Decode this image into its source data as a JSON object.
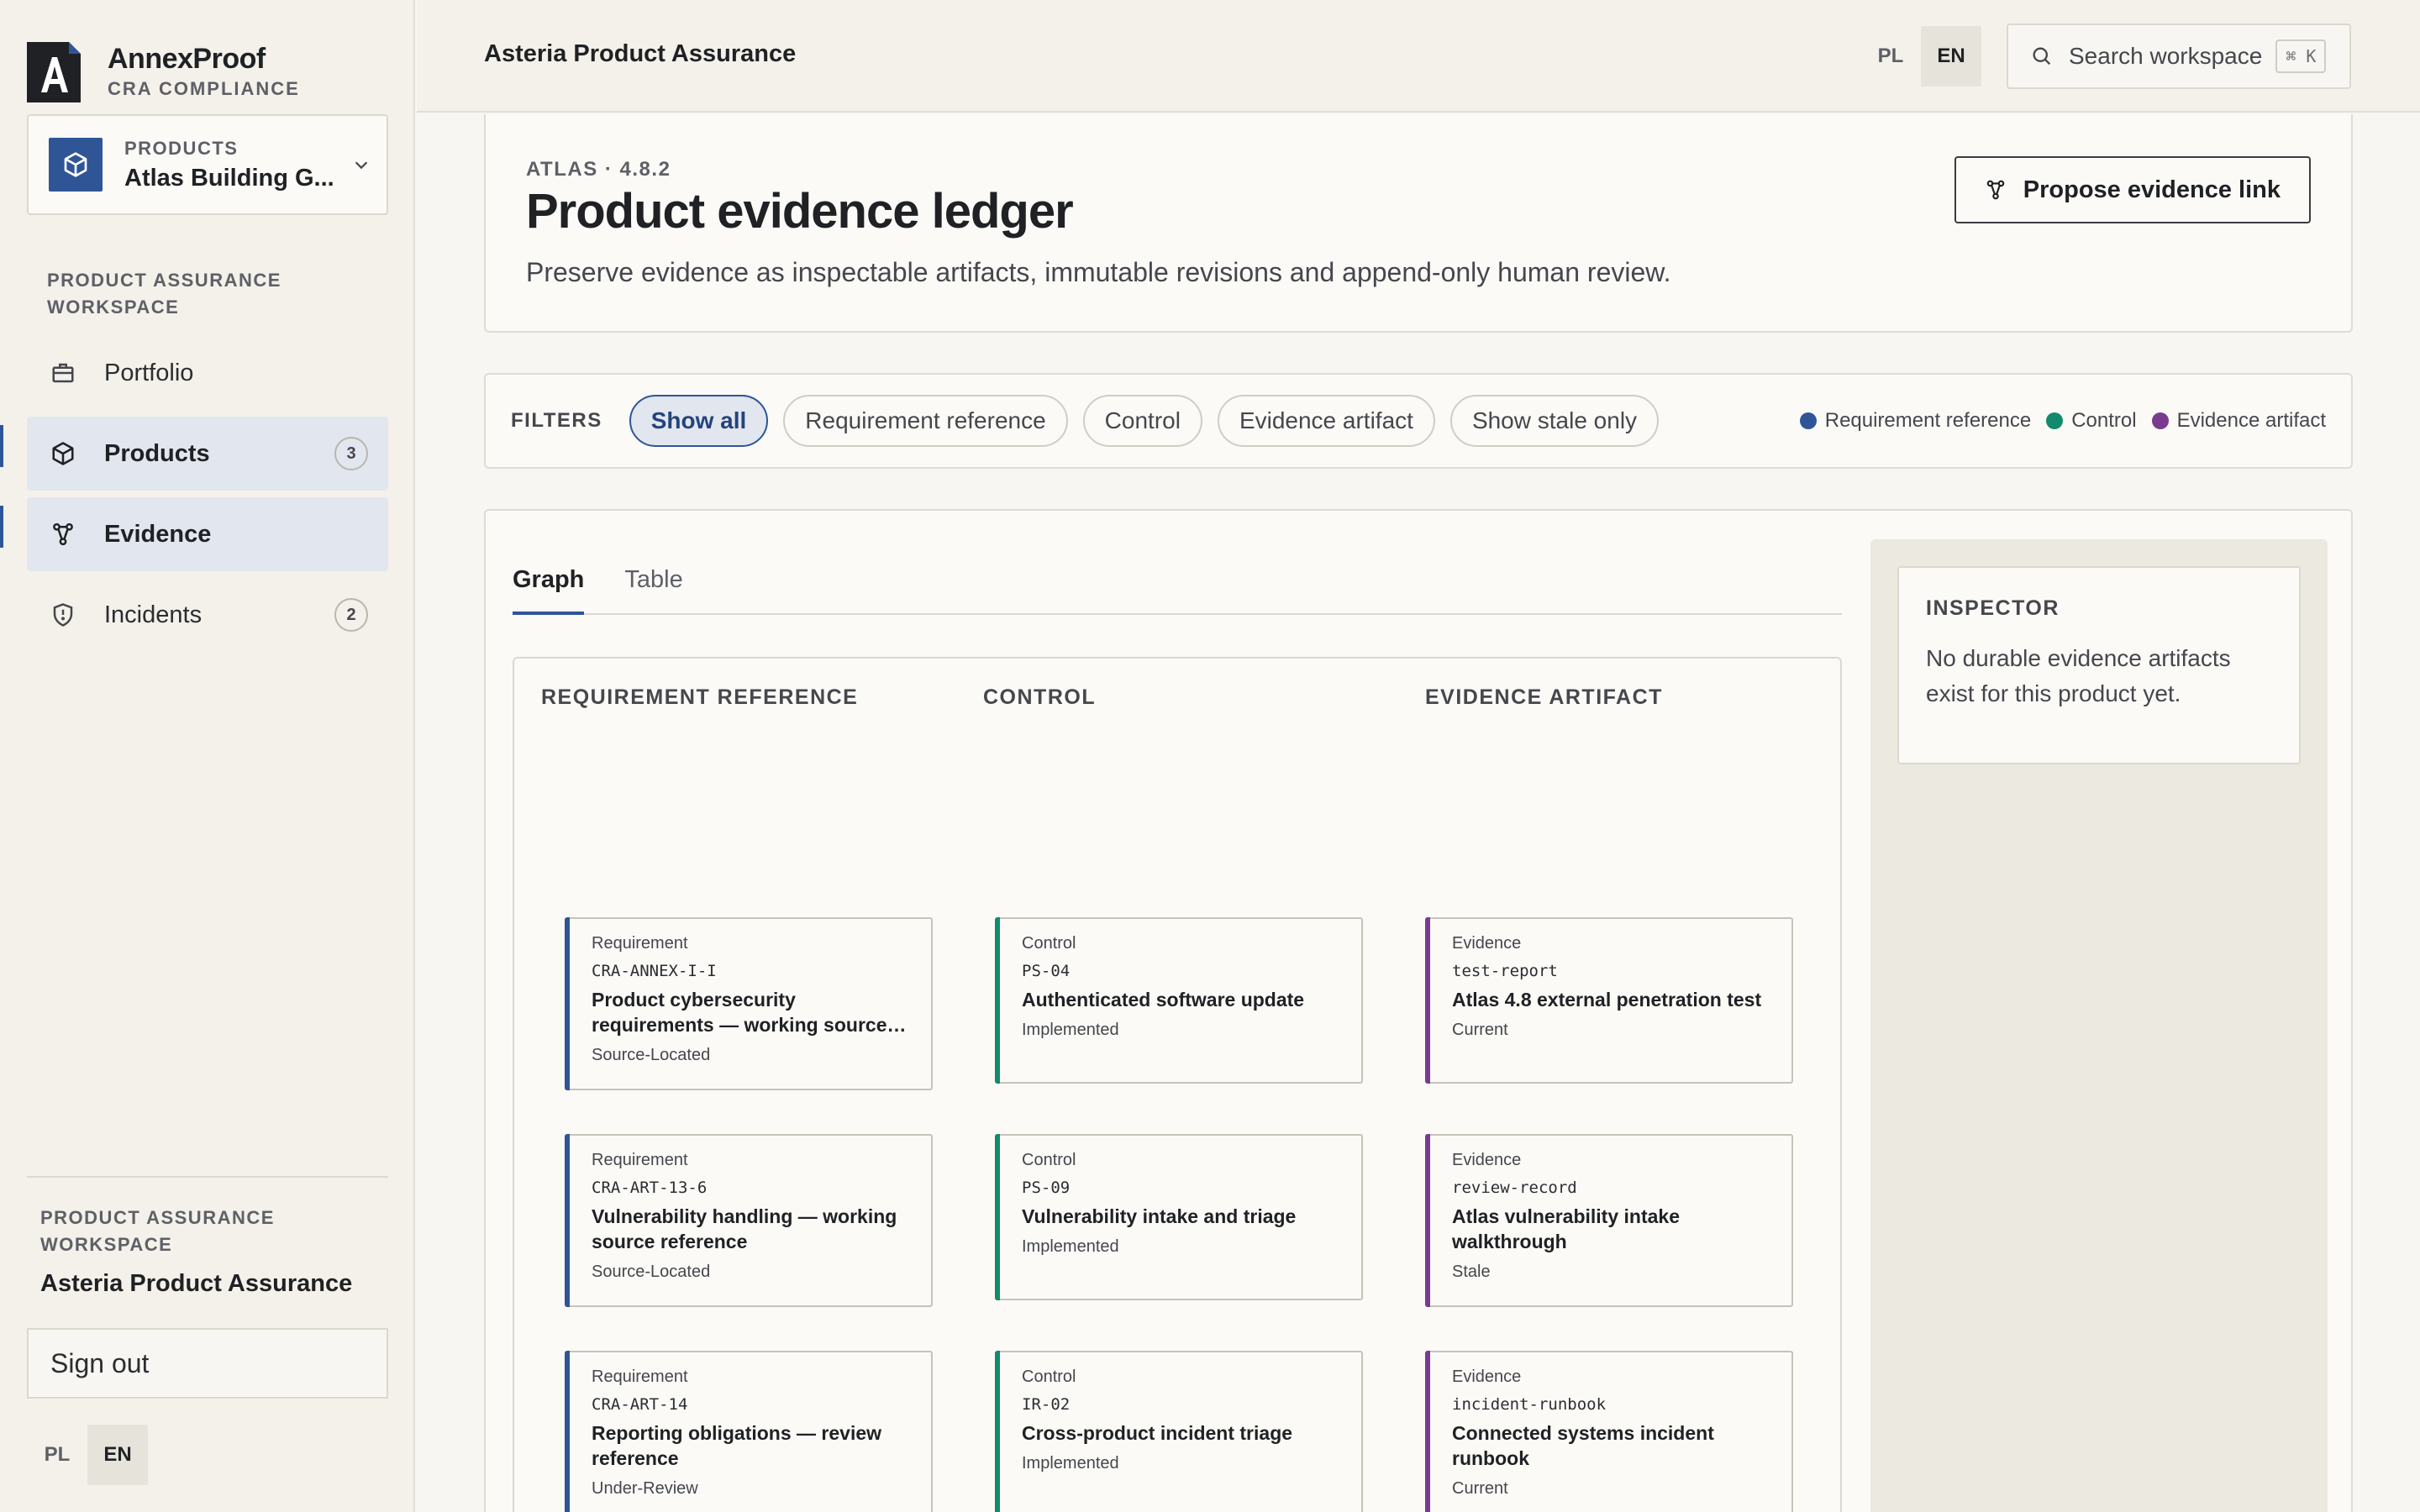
{
  "brand": {
    "name": "AnnexProof",
    "subtitle": "CRA COMPLIANCE",
    "logo_letter": "A"
  },
  "product_picker": {
    "label": "PRODUCTS",
    "value": "Atlas Building G..."
  },
  "sidebar": {
    "section_title": "PRODUCT ASSURANCE WORKSPACE",
    "items": [
      {
        "label": "Portfolio",
        "icon": "briefcase-icon",
        "active": false,
        "badge": ""
      },
      {
        "label": "Products",
        "icon": "cube-icon",
        "active": true,
        "badge": "3"
      },
      {
        "label": "Evidence",
        "icon": "graph-icon",
        "active": true,
        "badge": ""
      },
      {
        "label": "Incidents",
        "icon": "shield-alert-icon",
        "active": false,
        "badge": "2"
      }
    ],
    "footer": {
      "label": "PRODUCT ASSURANCE WORKSPACE",
      "workspace": "Asteria Product Assurance",
      "sign_out": "Sign out"
    },
    "lang": {
      "pl": "PL",
      "en": "EN",
      "active": "EN"
    }
  },
  "topbar": {
    "title": "Asteria Product Assurance",
    "lang": {
      "pl": "PL",
      "en": "EN",
      "active": "EN"
    },
    "search": {
      "placeholder": "Search workspace",
      "shortcut": "⌘ K"
    }
  },
  "header": {
    "eyebrow": "ATLAS · 4.8.2",
    "title": "Product evidence ledger",
    "description": "Preserve evidence as inspectable artifacts, immutable revisions and append-only human review.",
    "propose_button": "Propose evidence link"
  },
  "filters": {
    "label": "FILTERS",
    "chips": [
      "Show all",
      "Requirement reference",
      "Control",
      "Evidence artifact",
      "Show stale only"
    ],
    "active": "Show all",
    "legend": [
      {
        "label": "Requirement reference",
        "color": "#2f5597"
      },
      {
        "label": "Control",
        "color": "#138a6c"
      },
      {
        "label": "Evidence artifact",
        "color": "#7a3a8f"
      }
    ]
  },
  "tabs": {
    "graph": "Graph",
    "table": "Table",
    "active": "Graph"
  },
  "columns": {
    "requirement": "REQUIREMENT REFERENCE",
    "control": "CONTROL",
    "evidence": "EVIDENCE ARTIFACT"
  },
  "rows": [
    {
      "req": {
        "type": "Requirement",
        "code": "CRA-ANNEX-I-I",
        "title": "Product cybersecurity requirements — working source…",
        "status": "Source-Located"
      },
      "ctl": {
        "type": "Control",
        "code": "PS-04",
        "title": "Authenticated software update",
        "status": "Implemented"
      },
      "evi": {
        "type": "Evidence",
        "code": "test-report",
        "title": "Atlas 4.8 external penetration test",
        "status": "Current"
      }
    },
    {
      "req": {
        "type": "Requirement",
        "code": "CRA-ART-13-6",
        "title": "Vulnerability handling — working source reference",
        "status": "Source-Located"
      },
      "ctl": {
        "type": "Control",
        "code": "PS-09",
        "title": "Vulnerability intake and triage",
        "status": "Implemented"
      },
      "evi": {
        "type": "Evidence",
        "code": "review-record",
        "title": "Atlas vulnerability intake walkthrough",
        "status": "Stale"
      }
    },
    {
      "req": {
        "type": "Requirement",
        "code": "CRA-ART-14",
        "title": "Reporting obligations — review reference",
        "status": "Under-Review"
      },
      "ctl": {
        "type": "Control",
        "code": "IR-02",
        "title": "Cross-product incident triage",
        "status": "Implemented"
      },
      "evi": {
        "type": "Evidence",
        "code": "incident-runbook",
        "title": "Connected systems incident runbook",
        "status": "Current"
      }
    }
  ],
  "inspector": {
    "title": "INSPECTOR",
    "message": "No durable evidence artifacts exist for this product yet."
  }
}
